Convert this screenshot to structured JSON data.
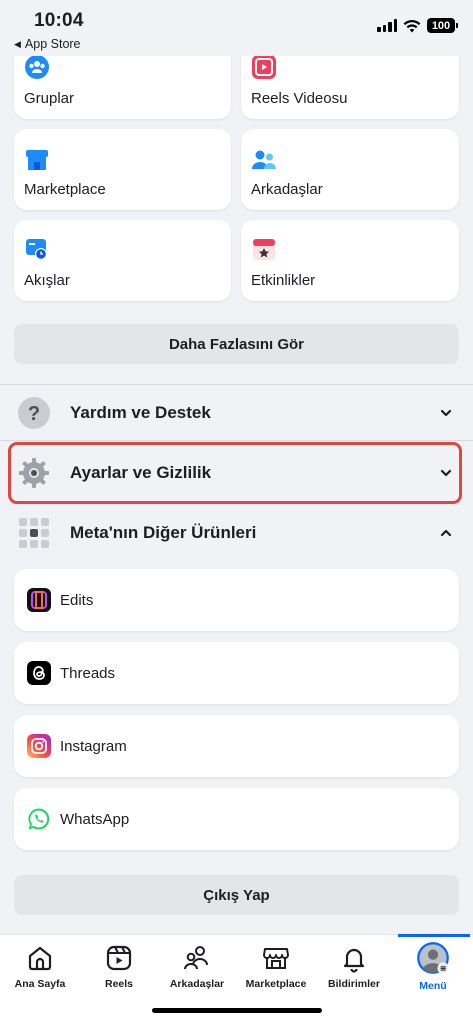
{
  "status_bar": {
    "time": "10:04",
    "back_label": "App Store",
    "battery": "100"
  },
  "shortcuts": [
    {
      "label": "Gruplar",
      "icon": "groups-icon"
    },
    {
      "label": "Reels Videosu",
      "icon": "reels-icon"
    },
    {
      "label": "Marketplace",
      "icon": "marketplace-icon"
    },
    {
      "label": "Arkadaşlar",
      "icon": "friends-icon"
    },
    {
      "label": "Akışlar",
      "icon": "feeds-icon"
    },
    {
      "label": "Etkinlikler",
      "icon": "events-icon"
    }
  ],
  "see_more_label": "Daha Fazlasını Gör",
  "sections": {
    "help": {
      "label": "Yardım ve Destek",
      "icon": "help-icon",
      "expanded": false
    },
    "settings": {
      "label": "Ayarlar ve Gizlilik",
      "icon": "gear-icon",
      "expanded": false
    },
    "meta": {
      "label": "Meta'nın Diğer Ürünleri",
      "icon": "apps-grid-icon",
      "expanded": true
    }
  },
  "meta_products": [
    {
      "label": "Edits",
      "icon": "edits-icon"
    },
    {
      "label": "Threads",
      "icon": "threads-icon"
    },
    {
      "label": "Instagram",
      "icon": "instagram-icon"
    },
    {
      "label": "WhatsApp",
      "icon": "whatsapp-icon"
    }
  ],
  "logout_label": "Çıkış Yap",
  "tabs": [
    {
      "label": "Ana Sayfa",
      "icon": "home-icon",
      "active": false
    },
    {
      "label": "Reels",
      "icon": "reels-tab-icon",
      "active": false
    },
    {
      "label": "Arkadaşlar",
      "icon": "friends-tab-icon",
      "active": false
    },
    {
      "label": "Marketplace",
      "icon": "marketplace-tab-icon",
      "active": false
    },
    {
      "label": "Bildirimler",
      "icon": "bell-icon",
      "active": false
    },
    {
      "label": "Menü",
      "icon": "profile-menu-icon",
      "active": true
    }
  ],
  "colors": {
    "accent": "#0866ff",
    "highlight": "#e0463c",
    "background": "#f1f2f6"
  }
}
